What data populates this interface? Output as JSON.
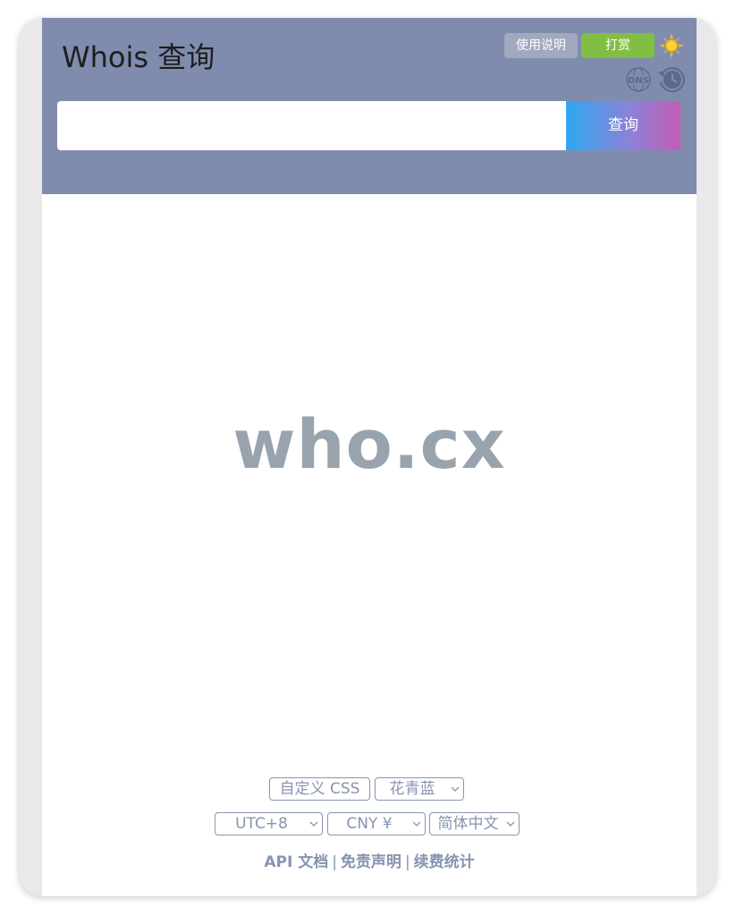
{
  "header": {
    "title": "Whois 查询",
    "help_label": "使用说明",
    "donate_label": "打赏",
    "dns_icon_text": "DNS"
  },
  "search": {
    "value": "",
    "placeholder": "",
    "button_label": "查询"
  },
  "logo_text": "who.cx",
  "settings": {
    "custom_css_label": "自定义 CSS",
    "theme_selected": "花青蓝",
    "timezone_selected": "UTC+8",
    "currency_selected": "CNY ¥",
    "language_selected": "简体中文"
  },
  "footer": {
    "links": [
      "API 文档",
      "免责声明",
      "续费统计"
    ],
    "separator": "|"
  },
  "colors": {
    "header_bg": "#7f8cad",
    "help_button": "#a1a9be",
    "donate_button": "#82be44",
    "logo_text": "#98a3ae",
    "control_text": "#8794b0"
  }
}
